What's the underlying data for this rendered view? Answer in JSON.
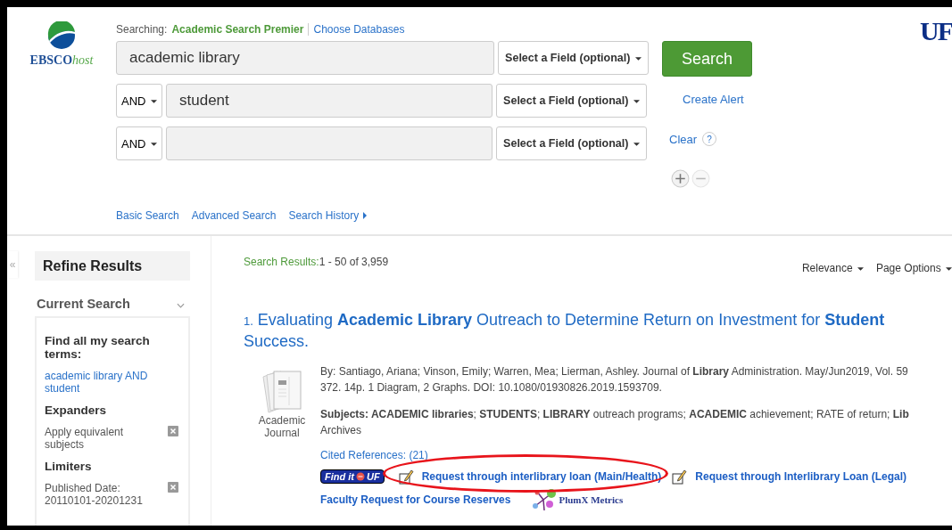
{
  "header": {
    "brand": "EBSCO",
    "brand_suffix": "host",
    "searching_label": "Searching:",
    "database": "Academic Search Premier",
    "choose_link": "Choose Databases",
    "university": "UF"
  },
  "search_rows": [
    {
      "operator": null,
      "value": "academic library",
      "field": "Select a Field (optional)"
    },
    {
      "operator": "AND",
      "value": "student",
      "field": "Select a Field (optional)"
    },
    {
      "operator": "AND",
      "value": null,
      "field": "Select a Field (optional)"
    }
  ],
  "search_button": "Search",
  "create_alert": "Create Alert",
  "clear": "Clear",
  "help": "?",
  "row_controls": [
    {
      "kind": "add",
      "disabled": false
    },
    {
      "kind": "remove",
      "disabled": true
    }
  ],
  "nav_links": [
    {
      "label": "Basic Search",
      "menu": false
    },
    {
      "label": "Advanced Search",
      "menu": false
    },
    {
      "label": "Search History",
      "menu": true
    }
  ],
  "sidebar": {
    "collapse": "«",
    "title": "Refine Results",
    "section": "Current Search",
    "expanded": true,
    "groups": [
      {
        "heading": "Find all my search terms:",
        "items": [
          {
            "text": "academic library AND student",
            "kind": "link"
          }
        ]
      },
      {
        "heading": "Expanders",
        "items": [
          {
            "text": "Apply equivalent subjects",
            "kind": "removable"
          }
        ]
      },
      {
        "heading": "Limiters",
        "items": [
          {
            "text": "Published Date: 20110101-20201231",
            "kind": "removable"
          }
        ]
      }
    ]
  },
  "results": {
    "summary_label": "Search Results:",
    "summary": "1 - 50 of 3,959",
    "sort": "Relevance",
    "page_options": "Page Options",
    "items": [
      {
        "number": "1.",
        "title": "Evaluating **Academic Library** Outreach to Determine Return on Investment for **Student** Success.",
        "type": "Academic Journal",
        "source": [
          "By: Santiago, Ariana; Vinson, Emily; Warren, Mea; Lierman, Ashley. Journal of **Library** Administration. May/Jun2019, Vol. 59",
          "372. 14p. 1 Diagram, 2 Graphs. DOI: 10.1080/01930826.2019.1593709."
        ],
        "subjects": [
          "**Subjects: ACADEMIC libraries**; **STUDENTS**; **LIBRARY** outreach programs; **ACADEMIC** achievement; RATE of return; **Lib**",
          "Archives"
        ],
        "cited": "Cited References: (21)",
        "find_it": {
          "left": "Find it",
          "right": "UF"
        },
        "requests": [
          {
            "label": "Request through interlibrary loan (Main/Health)",
            "circled": true
          },
          {
            "label": "Request through Interlibrary Loan (Legal)",
            "circled": false
          }
        ],
        "faculty": "Faculty Request for Course Reserves",
        "plumx": "PlumX Metrics"
      }
    ]
  }
}
